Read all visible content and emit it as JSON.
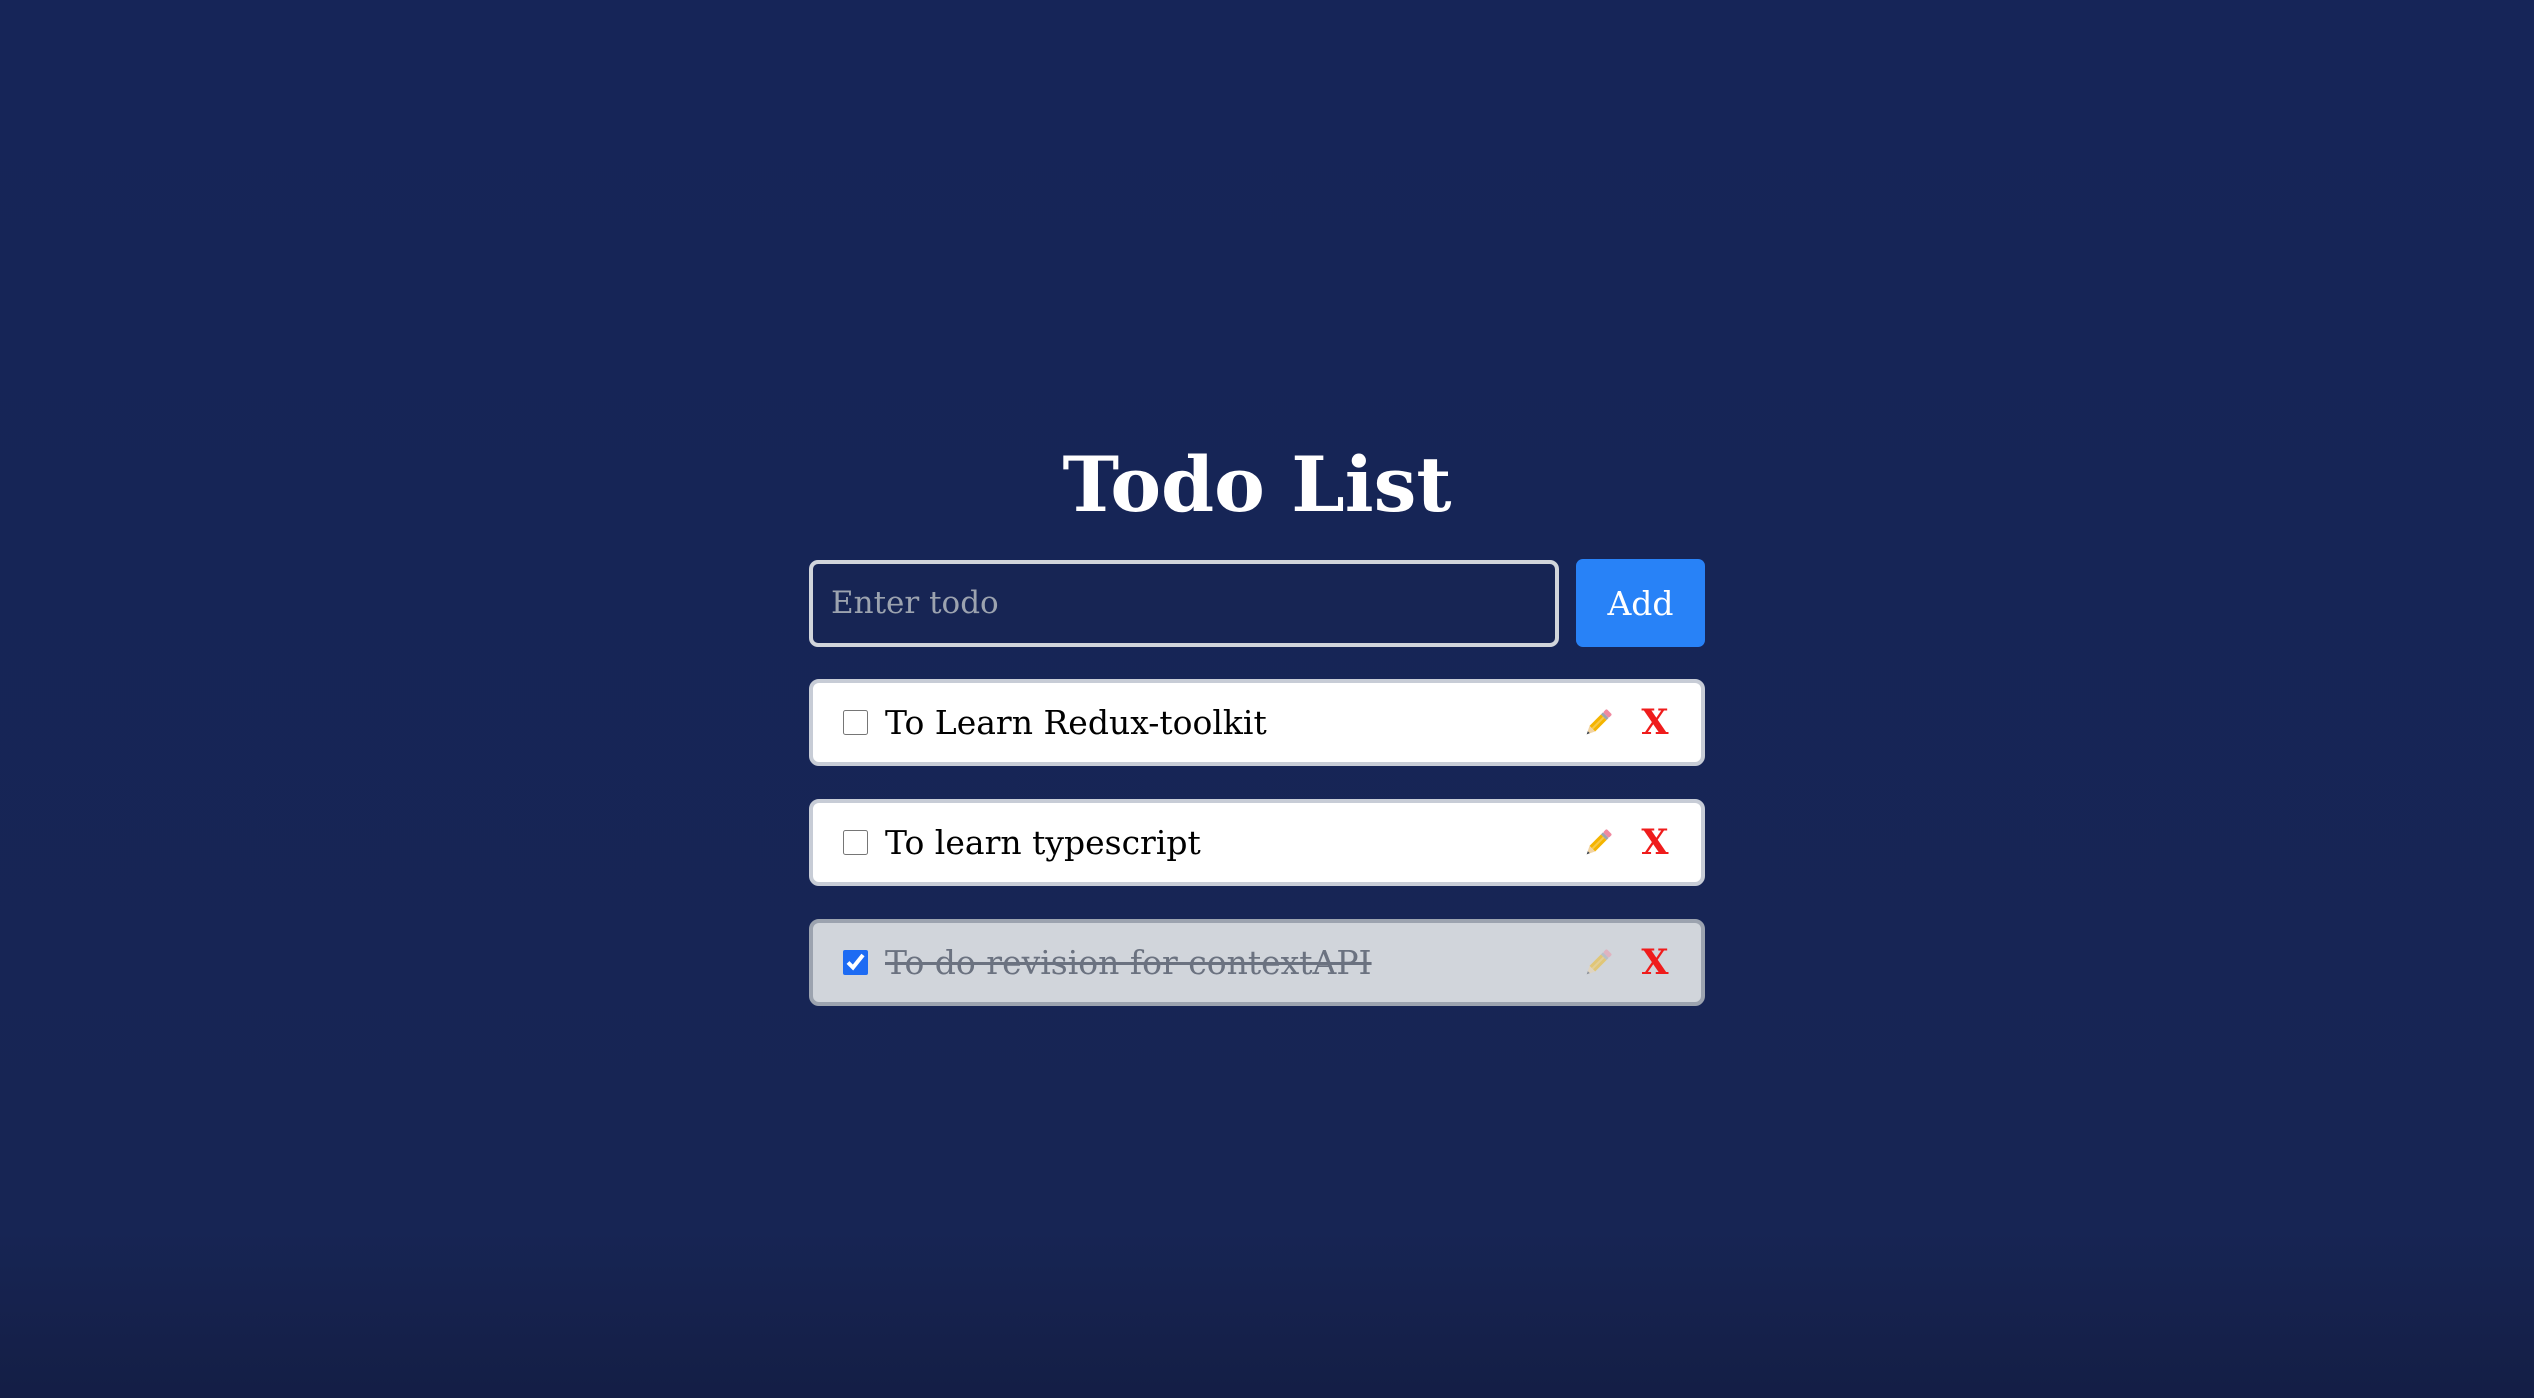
{
  "app": {
    "title": "Todo List"
  },
  "input": {
    "value": "",
    "placeholder": "Enter todo"
  },
  "buttons": {
    "add_label": "Add",
    "delete_label": "X"
  },
  "todos": [
    {
      "text": "To Learn Redux-toolkit",
      "completed": false
    },
    {
      "text": "To learn typescript",
      "completed": false
    },
    {
      "text": "To do revision for contextAPI",
      "completed": true
    }
  ],
  "colors": {
    "background": "#172554",
    "accent": "#2882f7",
    "delete": "#ef1c1c",
    "completed_background": "#d1d5db"
  },
  "icons": {
    "edit": "pencil-icon",
    "delete": "x-delete-icon"
  }
}
